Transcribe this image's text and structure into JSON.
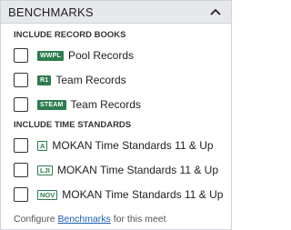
{
  "header": {
    "title": "BENCHMARKS",
    "collapse_icon": "chevron-up-icon"
  },
  "records": {
    "section_title": "INCLUDE RECORD BOOKS",
    "items": [
      {
        "badge": "WWPL",
        "label": "Pool Records",
        "checked": false
      },
      {
        "badge": "R1",
        "label": "Team Records",
        "checked": false
      },
      {
        "badge": "STEAM",
        "label": "Team Records",
        "checked": false
      }
    ]
  },
  "standards": {
    "section_title": "INCLUDE TIME STANDARDS",
    "items": [
      {
        "badge": "A",
        "label": "MOKAN Time Standards 11 & Up",
        "checked": false
      },
      {
        "badge": "LJI",
        "label": "MOKAN Time Standards 11 & Up",
        "checked": false
      },
      {
        "badge": "NOV",
        "label": "MOKAN Time Standards 11 & Up",
        "checked": false
      }
    ]
  },
  "footer": {
    "prefix": "Configure ",
    "link": "Benchmarks",
    "suffix": " for this meet"
  },
  "colors": {
    "accent_green": "#2e7d4f",
    "link_blue": "#1a5fb4",
    "header_bg": "#e6e8eb"
  }
}
